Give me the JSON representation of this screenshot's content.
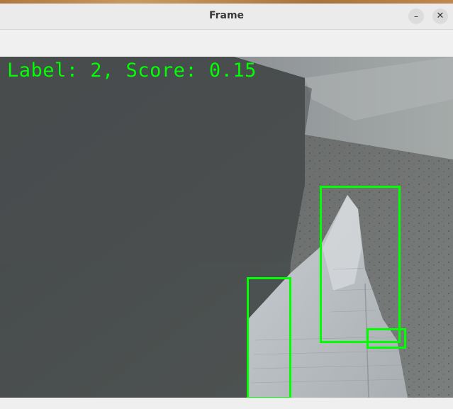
{
  "window": {
    "title": "Frame",
    "minimize_glyph": "–",
    "close_glyph": "✕"
  },
  "overlay": {
    "label_text": "Label: 2, Score: 0.15",
    "color": "#00ff00"
  },
  "detections": [
    {
      "name": "detection-box-1"
    },
    {
      "name": "detection-box-2"
    },
    {
      "name": "detection-box-3"
    }
  ]
}
